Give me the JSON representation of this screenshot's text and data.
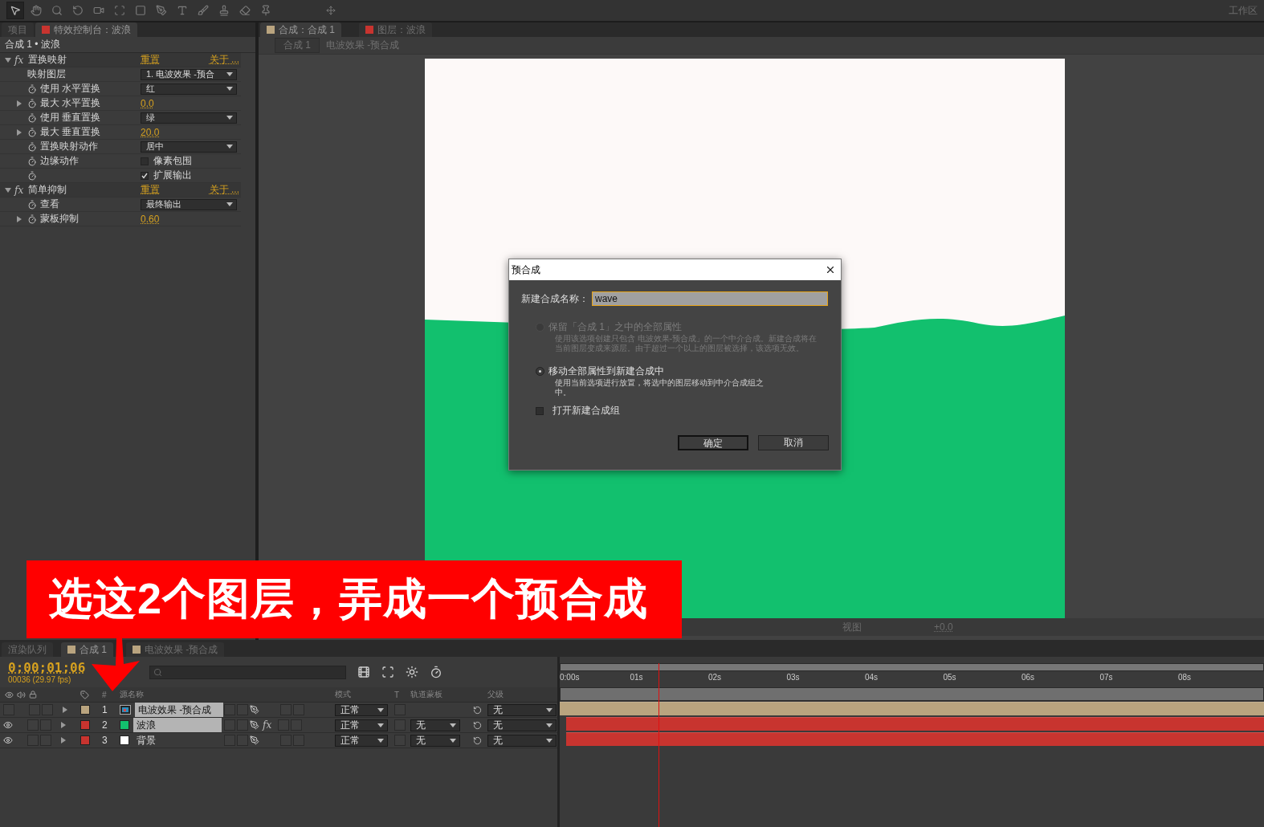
{
  "toolbar": {
    "tools": [
      {
        "selected": true
      },
      {
        "selected": false
      },
      {
        "selected": false
      },
      {
        "selected": false
      },
      {
        "selected": false
      },
      {
        "selected": false
      },
      {
        "selected": false
      },
      {
        "selected": false
      },
      {
        "selected": false
      },
      {
        "selected": false
      },
      {
        "selected": false
      },
      {
        "selected": false
      },
      {
        "selected": false
      }
    ],
    "workspace_label": "工作区"
  },
  "left_panel": {
    "tabs": [
      {
        "label": "项目",
        "selected": false
      },
      {
        "label": "特效控制台：波浪",
        "selected": true
      }
    ],
    "header": "合成 1 • 波浪",
    "effects": [
      {
        "name": "置换映射",
        "fx_label": "fx",
        "expanded": true,
        "reset": "重置",
        "about": "关于 ...",
        "properties": [
          {
            "kind": "dropdown",
            "label": "映射图层",
            "stopwatch": false,
            "expandable": false,
            "value": "1. 电波效果 -预合"
          },
          {
            "kind": "dropdown",
            "label": "使用 水平置换",
            "stopwatch": true,
            "expandable": false,
            "value": "红"
          },
          {
            "kind": "number",
            "label": "最大 水平置换",
            "stopwatch": true,
            "expandable": true,
            "value": "0.0"
          },
          {
            "kind": "dropdown",
            "label": "使用 垂直置换",
            "stopwatch": true,
            "expandable": false,
            "value": "绿"
          },
          {
            "kind": "number",
            "label": "最大 垂直置换",
            "stopwatch": true,
            "expandable": true,
            "value": "20.0"
          },
          {
            "kind": "dropdown",
            "label": "置换映射动作",
            "stopwatch": true,
            "expandable": false,
            "value": "居中"
          },
          {
            "kind": "checkbox",
            "label": "边缘动作",
            "stopwatch": true,
            "expandable": false,
            "value": "像素包围",
            "checked": false
          },
          {
            "kind": "checkbox",
            "stopwatch": true,
            "expandable": false,
            "value": "扩展输出",
            "checked": true
          }
        ]
      },
      {
        "name": "简单抑制",
        "fx_label": "fx",
        "expanded": true,
        "reset": "重置",
        "about": "关于 ...",
        "properties": [
          {
            "kind": "dropdown",
            "label": "查看",
            "stopwatch": true,
            "expandable": false,
            "value": "最终输出"
          },
          {
            "kind": "number",
            "label": "蒙板抑制",
            "stopwatch": true,
            "expandable": true,
            "value": "0.60"
          }
        ]
      }
    ]
  },
  "viewer": {
    "tabs": [
      {
        "label": "合成：合成 1",
        "selected": true,
        "color": "#b9a47f"
      },
      {
        "label": "图层：波浪",
        "selected": false,
        "color": "#c8342f"
      }
    ],
    "breadcrumb": [
      {
        "label": "合成 1"
      },
      {
        "label": "电波效果 -预合成"
      }
    ],
    "bottom_bar": {
      "view": "视图",
      "exposure": "+0.0"
    }
  },
  "dialog": {
    "title": "预合成",
    "name_label": "新建合成名称：",
    "name_value": "wave",
    "options": [
      {
        "label": "保留「合成 1」之中的全部属性",
        "description": "使用该选项创建只包含 电波效果-预合成」的一个中介合成。新建合成将在当前图层变成来源层。由于超过一个以上的图层被选择，该选项无效。",
        "selected": false,
        "disabled": true
      },
      {
        "label": "移动全部属性到新建合成中",
        "description": "使用当前选项进行放置，将选中的图层移动到中介合成组之中。",
        "selected": true,
        "disabled": false
      }
    ],
    "open_checkbox": {
      "label": "打开新建合成组",
      "checked": false
    },
    "buttons": [
      {
        "label": "确定",
        "default": true
      },
      {
        "label": "取消",
        "default": false
      }
    ]
  },
  "timeline": {
    "tabs": [
      {
        "label": "渲染队列",
        "selected": false
      },
      {
        "label": "合成 1",
        "selected": true,
        "color": "#b9a47f"
      },
      {
        "label": "电波效果 -预合成",
        "selected": false,
        "color": "#b9a47f"
      }
    ],
    "timecode": "0;00;01;06",
    "frame_info": "00036 (29.97 fps)",
    "columns": {
      "number": "#",
      "name": "源名称",
      "mode": "模式",
      "t": "T",
      "track_matte": "轨道蒙板",
      "parent": "父级"
    },
    "layers": [
      {
        "number": "1",
        "name": "电波效果 -预合成",
        "source": {
          "kind": "precomp"
        },
        "color": "#b9a47f",
        "visible": false,
        "selected": true,
        "mode": "正常",
        "parent": "无"
      },
      {
        "number": "2",
        "name": "波浪",
        "source": {
          "kind": "solid",
          "color": "#13c06e"
        },
        "color": "#c8342f",
        "visible": true,
        "selected": true,
        "fx_switch": "fx",
        "mode": "正常",
        "track_matte": "无",
        "parent": "无"
      },
      {
        "number": "3",
        "name": "背景",
        "source": {
          "kind": "solid",
          "color": "#ffffff"
        },
        "color": "#c8342f",
        "visible": true,
        "selected": false,
        "mode": "正常",
        "track_matte": "无",
        "parent": "无"
      }
    ],
    "ruler": [
      "0:00s",
      "01s",
      "02s",
      "03s",
      "04s",
      "05s",
      "06s",
      "07s",
      "08s"
    ]
  },
  "annotation": {
    "text": "选这2个图层，弄成一个预合成"
  }
}
